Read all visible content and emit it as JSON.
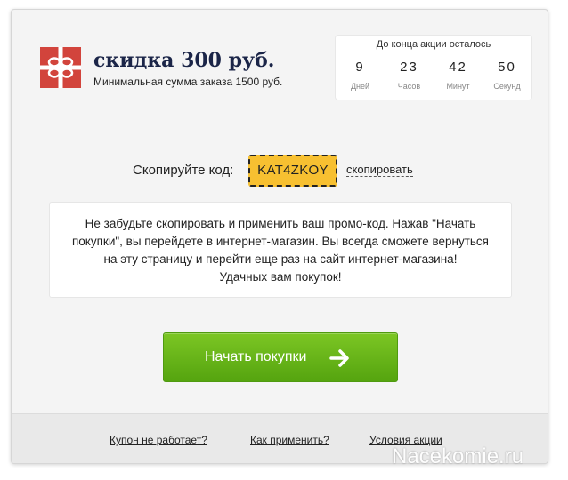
{
  "offer": {
    "title": "скидка 300 руб.",
    "subtitle": "Минимальная сумма заказа 1500 руб."
  },
  "countdown": {
    "title": "До конца акции осталось",
    "units": [
      {
        "value": "9",
        "label": "Дней"
      },
      {
        "value": "23",
        "label": "Часов"
      },
      {
        "value": "42",
        "label": "Минут"
      },
      {
        "value": "50",
        "label": "Секунд"
      }
    ]
  },
  "promo": {
    "label": "Скопируйте код:",
    "code": "KAT4ZKOY",
    "copy_label": "скопировать"
  },
  "notice": {
    "lines": [
      "Не забудьте скопировать и применить ваш промо-код. Нажав \"Начать",
      "покупки\", вы перейдете в интернет-магазин. Вы всегда сможете вернуться",
      "на эту страницу и перейти еще раз на сайт интернет-магазина!",
      "Удачных вам покупок!"
    ]
  },
  "cta": {
    "label": "Начать покупки"
  },
  "footer": {
    "links": [
      "Купон не работает?",
      "Как применить?",
      "Условия акции"
    ]
  },
  "watermark": "Nacekomie.ru",
  "colors": {
    "accent_green": "#6bb51b",
    "code_yellow": "#f7c031",
    "icon_red": "#d2443c",
    "title_navy": "#1b2548"
  },
  "icons": {
    "offer": "gift-icon",
    "cta": "arrow-right-icon"
  }
}
